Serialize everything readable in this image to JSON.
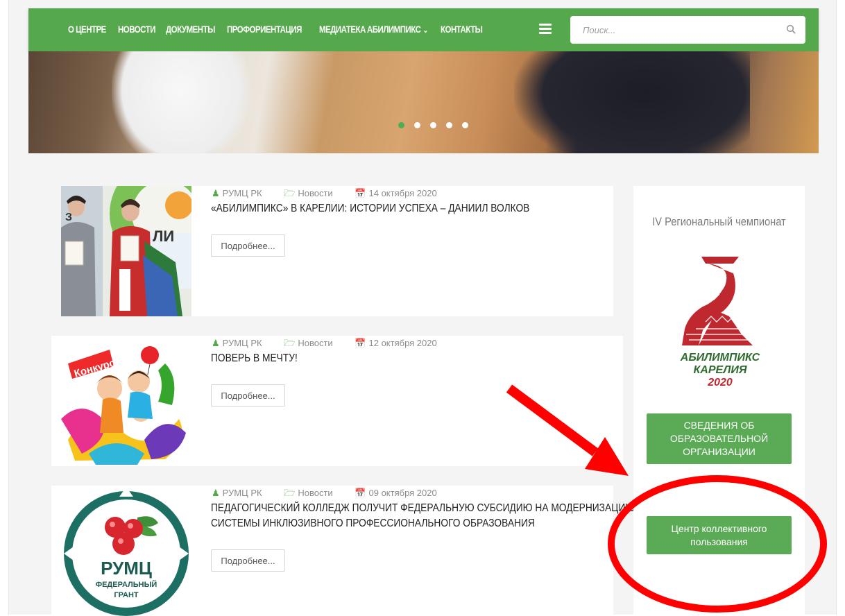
{
  "nav": {
    "items": [
      "О ЦЕНТРЕ",
      "НОВОСТИ",
      "ДОКУМЕНТЫ",
      "ПРОФОРИЕНТАЦИЯ",
      "МЕДИАТЕКА",
      "АБИЛИМПИКС",
      "КОНТАКТЫ"
    ],
    "search_placeholder": "Поиск..."
  },
  "slider": {
    "count": 5,
    "active": 1
  },
  "posts": [
    {
      "author": "РУМЦ РК",
      "category": "Новости",
      "date": "14 октября 2020",
      "title_lines": [
        "«АБИЛИМПИКС» В КАРЕЛИИ: ИСТОРИИ УСПЕХА – ДАНИИЛ ВОЛКОВ"
      ],
      "more": "Подробнее..."
    },
    {
      "author": "РУМЦ РК",
      "category": "Новости",
      "date": "12 октября 2020",
      "title_lines": [
        "ПОВЕРЬ В МЕЧТУ!"
      ],
      "more": "Подробнее...",
      "thumb_text": "Конкурс!"
    },
    {
      "author": "РУМЦ РК",
      "category": "Новости",
      "date": "09 октября 2020",
      "title_lines": [
        "ПЕДАГОГИЧЕСКИЙ КОЛЛЕДЖ ПОЛУЧИТ ФЕДЕРАЛЬНУЮ СУБСИДИЮ НА МОДЕРНИЗАЦИЮ",
        "СИСТЕМЫ ИНКЛЮЗИВНОГО ПРОФЕССИОНАЛЬНОГО ОБРАЗОВАНИЯ"
      ],
      "more": "Подробнее...",
      "thumb_logo": {
        "main": "РУМЦ",
        "sub1": "ФЕДЕРАЛЬНЫЙ",
        "sub2": "ГРАНТ"
      }
    }
  ],
  "sidebar": {
    "heading": "IV Региональный чемпионат",
    "logo_text": [
      "АБИЛИМПИКС",
      "КАРЕЛИЯ",
      "2020"
    ],
    "button1_lines": [
      "СВЕДЕНИЯ ОБ",
      "ОБРАЗОВАТЕЛЬНОЙ",
      "ОРГАНИЗАЦИИ"
    ],
    "button2_lines": [
      "Центр коллективного",
      "пользования"
    ]
  },
  "colors": {
    "brand_green": "#56a84c",
    "annotation_red": "#ff0000",
    "slider_active": "#4caf50"
  }
}
